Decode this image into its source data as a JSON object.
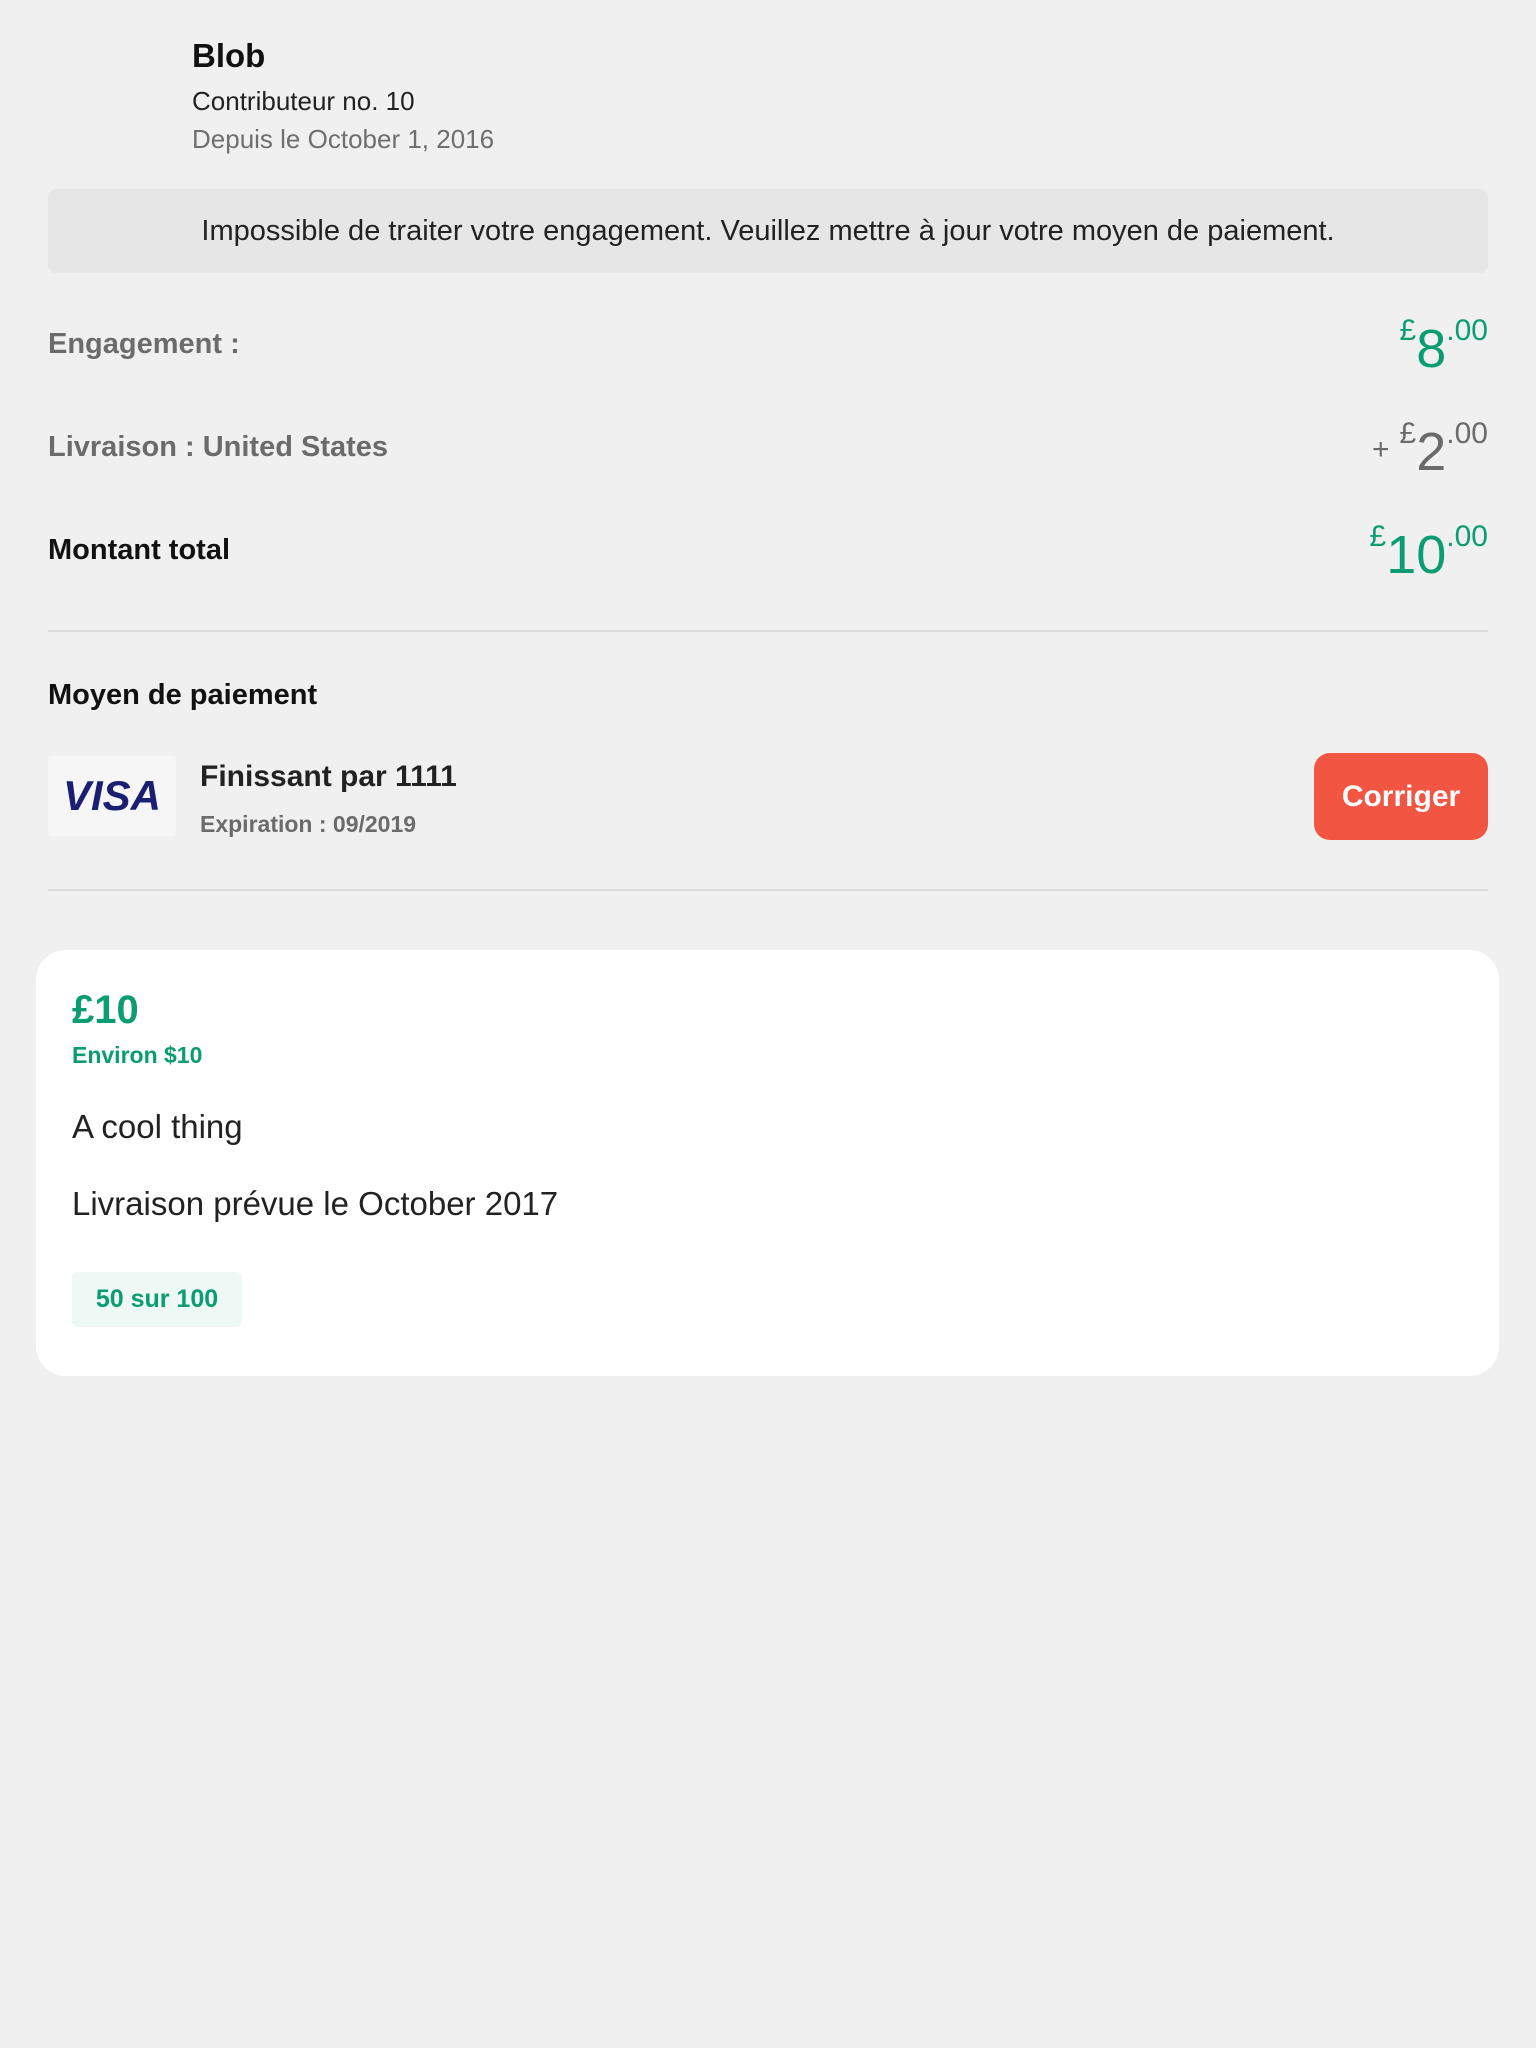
{
  "backer": {
    "name": "Blob",
    "number": "Contributeur no. 10",
    "since": "Depuis le October 1, 2016"
  },
  "alert": {
    "message": "Impossible de traiter votre engagement. Veuillez mettre à jour votre moyen de paiement."
  },
  "pledge": {
    "label": "Engagement :",
    "currency": "£",
    "integer": "8",
    "decimal": ".00"
  },
  "shipping": {
    "label": "Livraison : United States",
    "prefix": "+",
    "currency": "£",
    "integer": "2",
    "decimal": ".00"
  },
  "total": {
    "label": "Montant total",
    "currency": "£",
    "integer": "10",
    "decimal": ".00"
  },
  "payment": {
    "title": "Moyen de paiement",
    "card_brand": "VISA",
    "ending": "Finissant par 1111",
    "expiration": "Expiration : 09/2019",
    "fix_label": "Corriger"
  },
  "reward": {
    "amount": "£10",
    "approx": "Environ $10",
    "title": "A cool thing",
    "delivery": "Livraison prévue le October 2017",
    "limit": "50 sur 100"
  },
  "colors": {
    "green": "#0a9d72",
    "fix_button": "#f25541",
    "visa_blue": "#1a1f71",
    "background": "#f0f0f0"
  }
}
